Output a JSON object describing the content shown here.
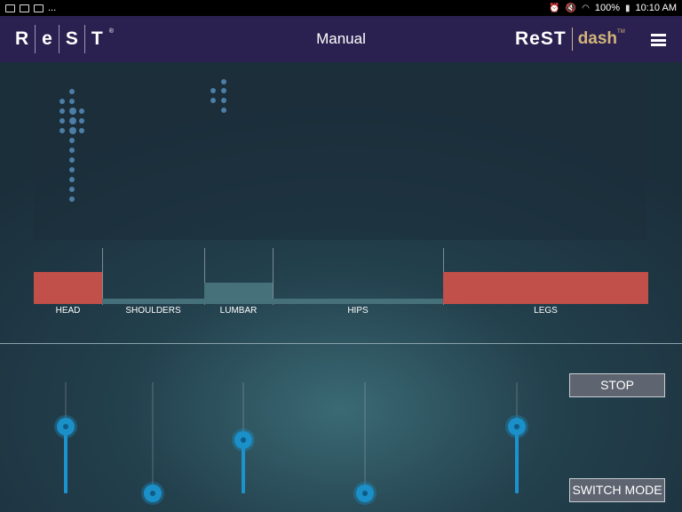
{
  "status_bar": {
    "left_text": "...",
    "battery": "100%",
    "time": "10:10 AM"
  },
  "app_bar": {
    "logo_letters": [
      "R",
      "e",
      "S",
      "T"
    ],
    "title": "Manual",
    "brand_rest": "ReST",
    "brand_dash": "dash",
    "brand_tm": "TM",
    "menu_icon": "hamburger-icon"
  },
  "zones": [
    {
      "label": "HEAD",
      "level": 0.6
    },
    {
      "label": "SHOULDERS",
      "level": 0.1
    },
    {
      "label": "LUMBAR",
      "level": 0.4
    },
    {
      "label": "HIPS",
      "level": 0.1
    },
    {
      "label": "LEGS",
      "level": 0.6
    }
  ],
  "sliders": [
    {
      "zone": "head",
      "level": 0.6
    },
    {
      "zone": "shoulders",
      "level": 0.0
    },
    {
      "zone": "lumbar",
      "level": 0.48
    },
    {
      "zone": "hips",
      "level": 0.0
    },
    {
      "zone": "legs",
      "level": 0.6
    }
  ],
  "buttons": {
    "stop": "STOP",
    "switch_mode": "SWITCH MODE"
  },
  "colors": {
    "app_bar": "#2b2150",
    "zone_active": "#c2504a",
    "zone_low": "#46707a",
    "slider_accent": "#1a93cf",
    "dash_gold": "#d2b47a"
  }
}
